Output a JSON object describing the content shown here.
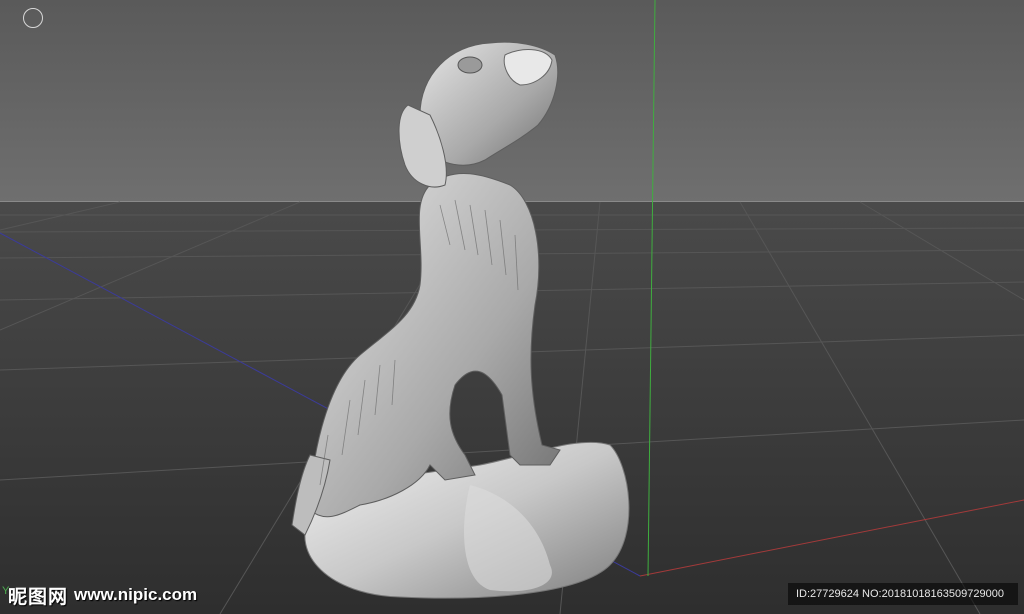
{
  "viewport": {
    "axis_label": "Y",
    "colors": {
      "sky": "#666666",
      "floor": "#3b3b3b",
      "y_axis": "#3fae3f",
      "x_axis": "#a33a3a",
      "z_axis": "#3b3b9a"
    }
  },
  "toolbar": {
    "circle_icon": "circle-icon"
  },
  "watermark": {
    "logo": "昵图网",
    "url": "www.nipic.com",
    "id_text": "ID:27729624 NO:20181018163509729000"
  }
}
